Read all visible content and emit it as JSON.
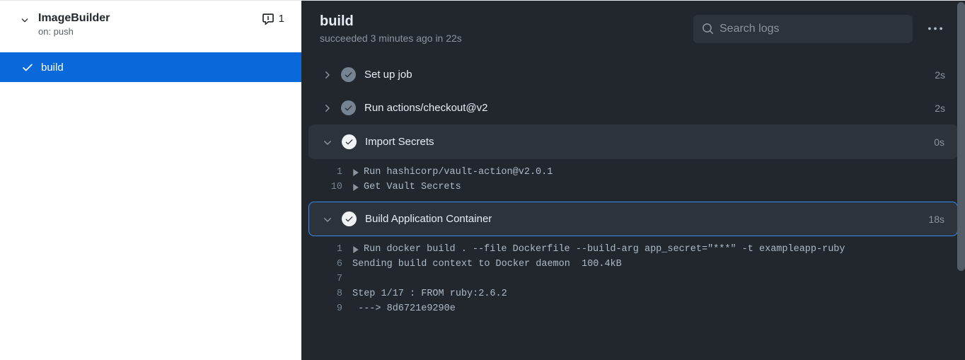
{
  "sidebar": {
    "workflow_name": "ImageBuilder",
    "trigger": "on: push",
    "annotation_count": "1",
    "jobs": [
      {
        "name": "build",
        "selected": true
      }
    ]
  },
  "header": {
    "job_name": "build",
    "status_line": "succeeded 3 minutes ago in 22s",
    "search_placeholder": "Search logs"
  },
  "icons": {
    "check": "check",
    "chev_down": "chev-down",
    "chev_right": "chev-right",
    "alert": "alert",
    "search": "search",
    "kebab": "kebab",
    "play": "play"
  },
  "steps": [
    {
      "name": "Set up job",
      "duration": "2s",
      "expanded": false,
      "status": "grey"
    },
    {
      "name": "Run actions/checkout@v2",
      "duration": "2s",
      "expanded": false,
      "status": "grey"
    },
    {
      "name": "Import Secrets",
      "duration": "0s",
      "expanded": true,
      "status": "white",
      "highlight": "bg",
      "logs": [
        {
          "n": "1",
          "caret": true,
          "text": "Run hashicorp/vault-action@v2.0.1"
        },
        {
          "n": "10",
          "caret": true,
          "text": "Get Vault Secrets"
        }
      ]
    },
    {
      "name": "Build Application Container",
      "duration": "18s",
      "expanded": true,
      "status": "white",
      "highlight": "sel",
      "logs": [
        {
          "n": "1",
          "caret": true,
          "text": "Run docker build . --file Dockerfile --build-arg app_secret=\"***\" -t exampleapp-ruby"
        },
        {
          "n": "6",
          "caret": false,
          "text": "Sending build context to Docker daemon  100.4kB"
        },
        {
          "n": "7",
          "caret": false,
          "text": ""
        },
        {
          "n": "8",
          "caret": false,
          "text": "Step 1/17 : FROM ruby:2.6.2"
        },
        {
          "n": "9",
          "caret": false,
          "text": " ---> 8d6721e9290e"
        }
      ]
    }
  ]
}
